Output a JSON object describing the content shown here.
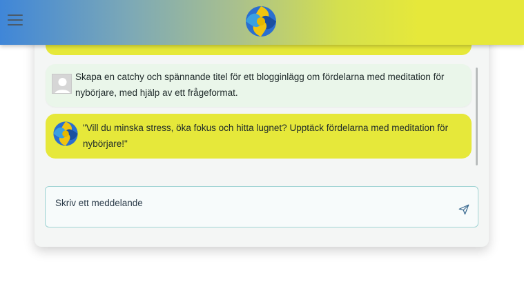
{
  "header": {
    "menu_icon": "hamburger-menu-icon",
    "logo_icon": "swirl-logo-icon"
  },
  "chat": {
    "messages": [
      {
        "role": "user",
        "avatar_icon": "user-placeholder-icon",
        "text": "Skapa en catchy och spännande titel för ett blogginlägg om fördelarna med meditation för nybörjare, med hjälp av ett frågeformat."
      },
      {
        "role": "assistant",
        "avatar_icon": "swirl-logo-icon",
        "text": "\"Vill du minska stress, öka fokus och hitta lugnet? Upptäck fördelarna med meditation för nybörjare!\""
      }
    ]
  },
  "composer": {
    "placeholder": "Skriv ett meddelande",
    "value": "",
    "send_icon": "send-icon"
  },
  "colors": {
    "accent_yellow": "#e6e83a",
    "accent_blue": "#3f86d8",
    "user_bubble": "#eaf6ea",
    "input_border": "#9fd3d3"
  }
}
